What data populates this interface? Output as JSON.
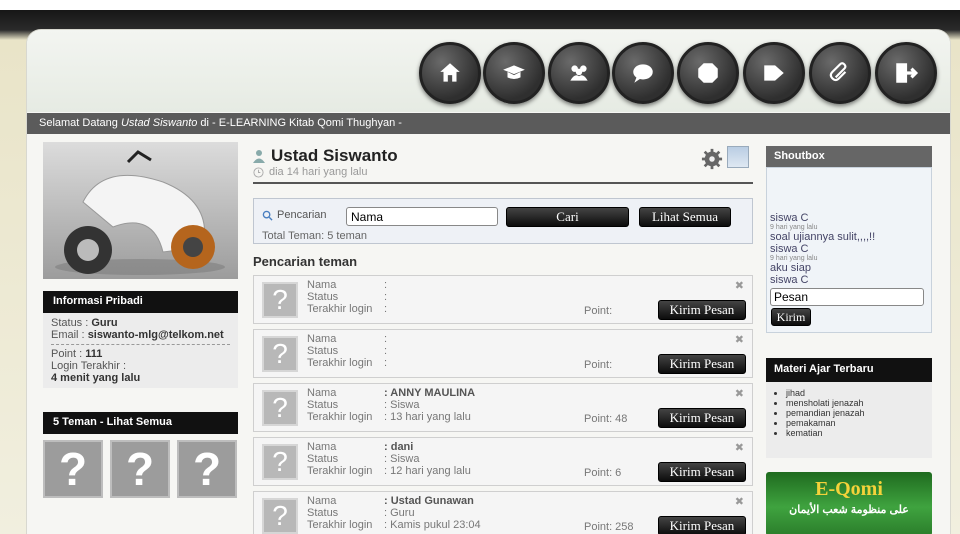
{
  "welcome": {
    "prefix": "Selamat Datang ",
    "user": "Ustad Siswanto",
    "suffix": " di - E-LEARNING Kitab Qomi Thughyan -"
  },
  "nav": [
    "home-icon",
    "teacher-icon",
    "group-icon",
    "chat-bubble-icon",
    "box-icon",
    "tag-icon",
    "paperclip-icon",
    "logout-icon"
  ],
  "left": {
    "info_title": "Informasi Pribadi",
    "status_label": "Status : ",
    "status_value": "Guru",
    "email_label": "Email : ",
    "email_value": "siswanto-mlg@telkom.net",
    "point_label": "Point : ",
    "point_value": "111",
    "login_label": "Login Terakhir :",
    "login_value": "4 menit yang lalu",
    "friends_title": "5 Teman - Lihat Semua",
    "friend_placeholder": "?"
  },
  "profile": {
    "name": "Ustad Siswanto",
    "time": "dia 14 hari yang lalu"
  },
  "search": {
    "label": "Pencarian",
    "value": "Nama",
    "button": "Cari",
    "view_all": "Lihat Semua",
    "total": "Total Teman: 5 teman"
  },
  "section_title": "Pencarian teman",
  "labels": {
    "nama": "Nama",
    "status": "Status",
    "login": "Terakhir login",
    "point": "Point",
    "send": "Kirim Pesan",
    "close": "✖"
  },
  "friends": [
    {
      "nama": ":",
      "status": ":",
      "login": ":",
      "point": "Point:"
    },
    {
      "nama": ":",
      "status": ":",
      "login": ":",
      "point": "Point:"
    },
    {
      "nama": ": ANNY MAULINA",
      "status": ": Siswa",
      "login": ": 13 hari yang lalu",
      "point": "Point: 48"
    },
    {
      "nama": ": dani",
      "status": ": Siswa",
      "login": ": 12 hari yang lalu",
      "point": "Point: 6"
    },
    {
      "nama": ": Ustad Gunawan",
      "status": ": Guru",
      "login": ": Kamis pukul 23:04",
      "point": "Point: 258"
    }
  ],
  "shoutbox": {
    "title": "Shoutbox",
    "messages": [
      {
        "user": "siswa C",
        "time": "9 hari yang lalu",
        "msg": "soal ujiannya sulit,,,,!!"
      },
      {
        "user": "siswa C",
        "time": "9 hari yang lalu",
        "msg": "aku siap"
      },
      {
        "user": "siswa C",
        "time": "",
        "msg": ""
      }
    ],
    "placeholder": "Pesan",
    "send": "Kirim"
  },
  "materi": {
    "title": "Materi Ajar Terbaru",
    "items": [
      "jihad",
      "mensholati jenazah",
      "pemandian jenazah",
      "pemakaman",
      "kematian"
    ]
  },
  "banner": {
    "title": "E-Qomi",
    "subtitle": "على منظومة شعب الأيمان"
  }
}
